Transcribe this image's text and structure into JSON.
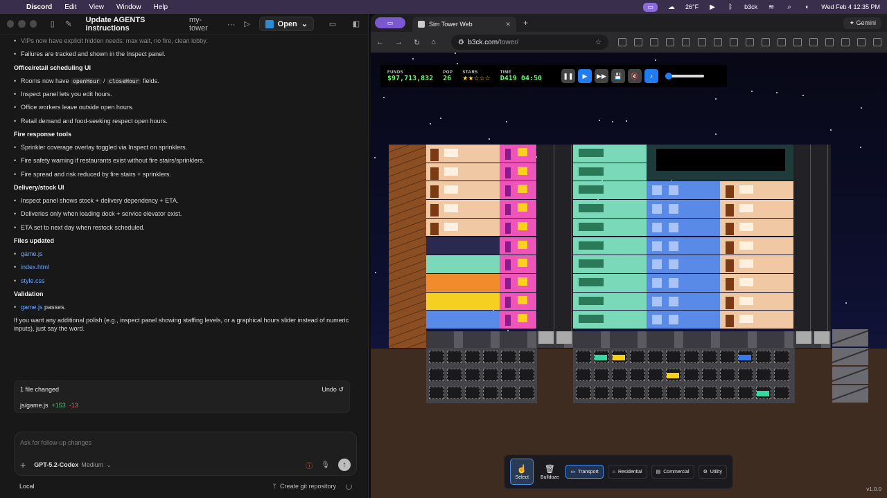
{
  "menubar": {
    "app": "Discord",
    "menus": [
      "Edit",
      "View",
      "Window",
      "Help"
    ],
    "weather": "26°F",
    "user": "b3ck",
    "datetime": "Wed Feb 4  12:35 PM"
  },
  "codex": {
    "title": "Update AGENTS instructions",
    "project": "my-tower",
    "open_label": "Open",
    "faded_item": "VIPs now have explicit hidden needs: max wait, no fire, clean lobby.",
    "intro_items": [
      "Failures are tracked and shown in the Inspect panel."
    ],
    "sections": [
      {
        "heading": "Office/retail scheduling UI",
        "items": [
          {
            "pre": "Rooms now have ",
            "code1": "openHour",
            "mid": " / ",
            "code2": "closeHour",
            "post": " fields."
          },
          {
            "text": "Inspect panel lets you edit hours."
          },
          {
            "text": "Office workers leave outside open hours."
          },
          {
            "text": "Retail demand and food-seeking respect open hours."
          }
        ]
      },
      {
        "heading": "Fire response tools",
        "items": [
          {
            "text": "Sprinkler coverage overlay toggled via Inspect on sprinklers."
          },
          {
            "text": "Fire safety warning if restaurants exist without fire stairs/sprinklers."
          },
          {
            "text": "Fire spread and risk reduced by fire stairs + sprinklers."
          }
        ]
      },
      {
        "heading": "Delivery/stock UI",
        "items": [
          {
            "text": "Inspect panel shows stock + delivery dependency + ETA."
          },
          {
            "text": "Deliveries only when loading dock + service elevator exist."
          },
          {
            "text": "ETA set to next day when restock scheduled."
          }
        ]
      }
    ],
    "files_heading": "Files updated",
    "files": [
      "game.js",
      "index.html",
      "style.css"
    ],
    "validation_heading": "Validation",
    "validation_file": "game.js",
    "validation_suffix": " passes.",
    "closing": "If you want any additional polish (e.g., inspect panel showing staffing levels, or a graphical hours slider instead of numeric inputs), just say the word.",
    "changes": {
      "summary": "1 file changed",
      "undo": "Undo",
      "file": "js/game.js",
      "added": "+153",
      "removed": "-13"
    },
    "compose": {
      "placeholder": "Ask for follow-up changes",
      "model": "GPT-5.2-Codex",
      "effort": "Medium"
    },
    "footer": {
      "location": "Local",
      "git": "Create git repository"
    }
  },
  "browser": {
    "tab_title": "Sim Tower Web",
    "url_host": "b3ck.com",
    "url_path": "/tower/",
    "gemini": "Gemini"
  },
  "game": {
    "hud": {
      "funds_label": "FUNDS",
      "funds": "$97,713,832",
      "pop_label": "POP",
      "pop": "26",
      "stars_label": "STARS",
      "stars": "★★☆☆☆",
      "time_label": "TIME",
      "time": "D419 04:50"
    },
    "tools": {
      "select": "Select",
      "bulldoze": "Bulldoze"
    },
    "categories": [
      "Transport",
      "Residential",
      "Commercial",
      "Utility"
    ],
    "version": "v1.0.0"
  }
}
